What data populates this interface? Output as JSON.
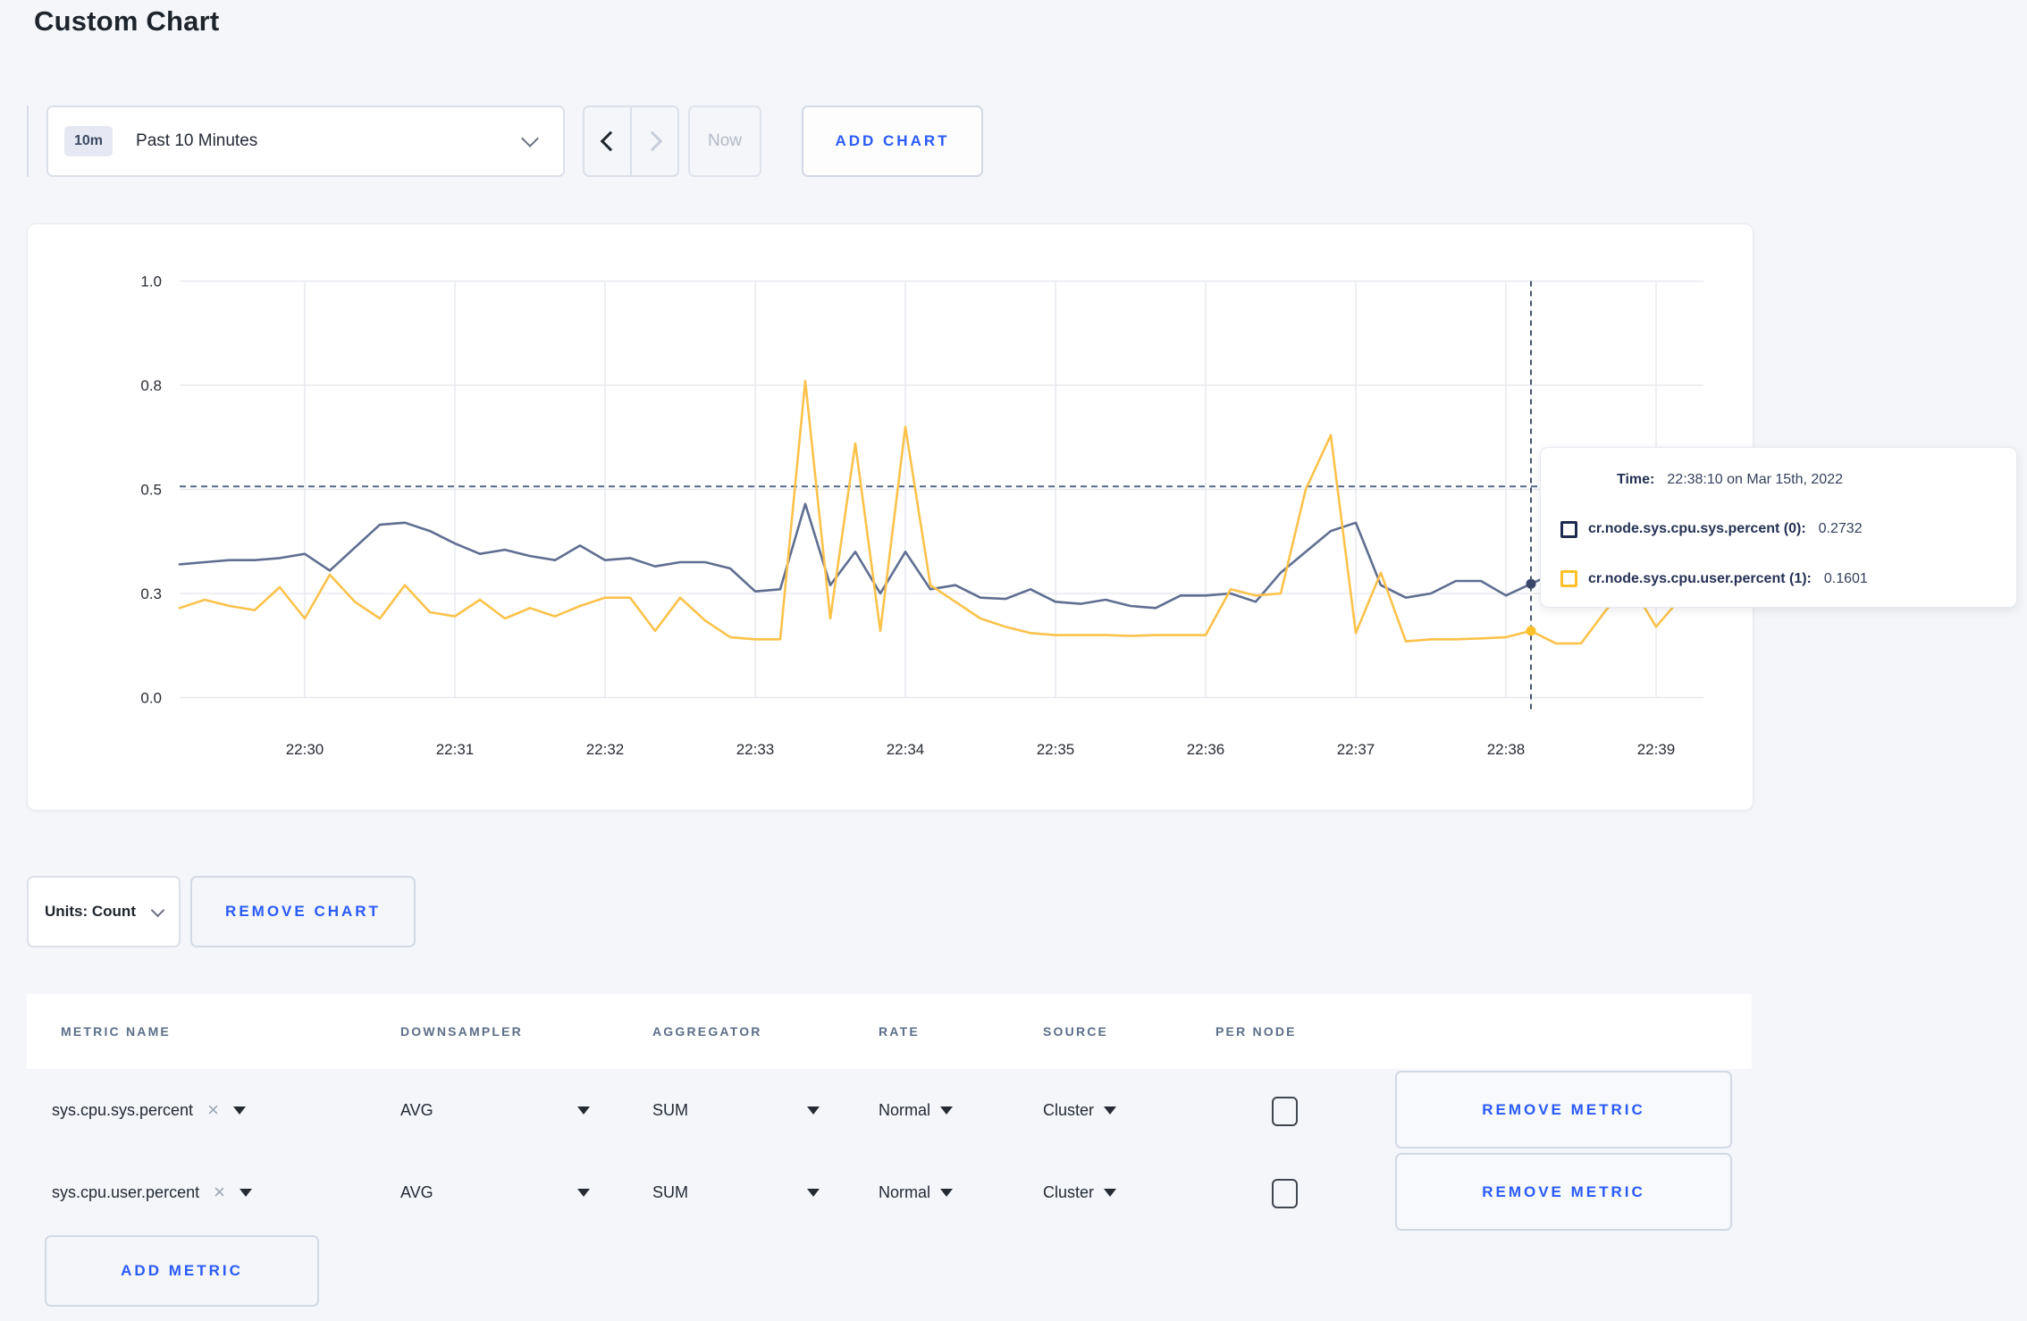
{
  "page": {
    "title": "Custom Chart"
  },
  "toolbar": {
    "time_range": {
      "badge": "10m",
      "label": "Past 10 Minutes"
    },
    "now_label": "Now",
    "add_chart_label": "ADD CHART"
  },
  "chart_data": {
    "type": "line",
    "title": "",
    "xlabel": "",
    "ylabel": "",
    "ylim": [
      0,
      1
    ],
    "grid": true,
    "legend_position": "none",
    "start_time": "22:29:10",
    "interval_seconds": 10,
    "x_ticks": [
      "22:30",
      "22:31",
      "22:32",
      "22:33",
      "22:34",
      "22:35",
      "22:36",
      "22:37",
      "22:38",
      "22:39"
    ],
    "y_ticks": [
      {
        "label": "0.0",
        "value": 0
      },
      {
        "label": "0.3",
        "value": 0.25
      },
      {
        "label": "0.5",
        "value": 0.5
      },
      {
        "label": "0.8",
        "value": 0.75
      },
      {
        "label": "1.0",
        "value": 1
      }
    ],
    "series": [
      {
        "name": "cr.node.sys.cpu.sys.percent",
        "color": "#5f6e91",
        "dot_color": "#39476b",
        "values": [
          0.32,
          0.325,
          0.33,
          0.33,
          0.335,
          0.345,
          0.305,
          0.36,
          0.415,
          0.42,
          0.4,
          0.37,
          0.345,
          0.355,
          0.34,
          0.33,
          0.365,
          0.33,
          0.335,
          0.315,
          0.325,
          0.325,
          0.31,
          0.255,
          0.26,
          0.465,
          0.27,
          0.35,
          0.25,
          0.35,
          0.26,
          0.27,
          0.24,
          0.237,
          0.26,
          0.23,
          0.225,
          0.235,
          0.22,
          0.215,
          0.245,
          0.245,
          0.25,
          0.23,
          0.3,
          0.35,
          0.4,
          0.42,
          0.27,
          0.24,
          0.25,
          0.28,
          0.28,
          0.245,
          0.2732,
          0.3,
          0.31,
          0.315,
          0.3,
          0.3,
          0.305
        ]
      },
      {
        "name": "cr.node.sys.cpu.user.percent",
        "color": "#fcc24a",
        "dot_color": "#fdc028",
        "values": [
          0.215,
          0.235,
          0.22,
          0.21,
          0.265,
          0.19,
          0.295,
          0.23,
          0.19,
          0.27,
          0.205,
          0.195,
          0.235,
          0.19,
          0.215,
          0.195,
          0.22,
          0.24,
          0.24,
          0.16,
          0.24,
          0.185,
          0.145,
          0.14,
          0.14,
          0.76,
          0.19,
          0.61,
          0.16,
          0.65,
          0.27,
          0.23,
          0.19,
          0.17,
          0.155,
          0.15,
          0.15,
          0.15,
          0.148,
          0.15,
          0.15,
          0.15,
          0.26,
          0.245,
          0.25,
          0.5,
          0.63,
          0.155,
          0.3,
          0.135,
          0.14,
          0.14,
          0.142,
          0.145,
          0.1601,
          0.13,
          0.13,
          0.21,
          0.27,
          0.17,
          0.24
        ]
      }
    ],
    "crosshair": {
      "x_index": 54,
      "hline_value": 0.507,
      "time": "22:38:10"
    }
  },
  "tooltip": {
    "time_label": "Time:",
    "time_value": "22:38:10 on Mar 15th, 2022",
    "rows": [
      {
        "name": "cr.node.sys.cpu.sys.percent (0):",
        "value": "0.2732",
        "color": "#1d2b4e"
      },
      {
        "name": "cr.node.sys.cpu.user.percent (1):",
        "value": "0.1601",
        "color": "#fdc028"
      }
    ]
  },
  "units_bar": {
    "units_label": "Units: Count",
    "remove_chart_label": "REMOVE CHART"
  },
  "metrics_table": {
    "headers": [
      "METRIC NAME",
      "DOWNSAMPLER",
      "AGGREGATOR",
      "RATE",
      "SOURCE",
      "PER NODE"
    ],
    "rows": [
      {
        "metric": "sys.cpu.sys.percent",
        "downsampler": "AVG",
        "aggregator": "SUM",
        "rate": "Normal",
        "source": "Cluster",
        "per_node_checked": false,
        "remove_label": "REMOVE METRIC"
      },
      {
        "metric": "sys.cpu.user.percent",
        "downsampler": "AVG",
        "aggregator": "SUM",
        "rate": "Normal",
        "source": "Cluster",
        "per_node_checked": false,
        "remove_label": "REMOVE METRIC"
      }
    ],
    "add_metric_label": "ADD METRIC"
  }
}
